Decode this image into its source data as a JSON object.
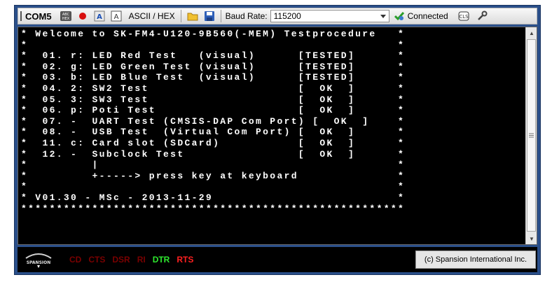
{
  "toolbar": {
    "port": "COM5",
    "mode_label": "ASCII / HEX",
    "baud_label": "Baud Rate:",
    "baud_value": "115200",
    "connection_status": "Connected",
    "icons": [
      "hex-toggle-icon",
      "record-dot-icon",
      "abc-font-icon",
      "a-letter-icon",
      "open-folder-icon",
      "save-disk-icon",
      "dropdown-arrow-icon",
      "connected-check-icon",
      "clear-screen-icon",
      "settings-wrench-icon"
    ]
  },
  "terminal": {
    "lines": [
      "* Welcome to SK-FM4-U120-9B560(-MEM) Testprocedure   *",
      "*                                                    *",
      "*  01. r: LED Red Test   (visual)      [TESTED]      *",
      "*  02. g: LED Green Test (visual)      [TESTED]      *",
      "*  03. b: LED Blue Test  (visual)      [TESTED]      *",
      "*  04. 2: SW2 Test                     [  OK  ]      *",
      "*  05. 3: SW3 Test                     [  OK  ]      *",
      "*  06. p: Poti Test                    [  OK  ]      *",
      "*  07. -  UART Test (CMSIS-DAP Com Port) [  OK  ]    *",
      "*  08. -  USB Test  (Virtual Com Port) [  OK  ]      *",
      "*  11. c: Card slot (SDCard)           [  OK  ]      *",
      "*  12. -  Subclock Test                [  OK  ]      *",
      "*         |                                          *",
      "*         +-----> press key at keyboard              *",
      "*                                                    *",
      "* V01.30 - MSc - 2013-11-29                          *",
      "******************************************************"
    ]
  },
  "statusbar": {
    "logo_text": "SPANSION",
    "signals": [
      {
        "label": "CD",
        "color": "#7a0000"
      },
      {
        "label": "CTS",
        "color": "#7a0000"
      },
      {
        "label": "DSR",
        "color": "#7a0000"
      },
      {
        "label": "RI",
        "color": "#7a0000"
      },
      {
        "label": "DTR",
        "color": "#2ee82e"
      },
      {
        "label": "RTS",
        "color": "#ff2020"
      }
    ],
    "copyright": "(c) Spansion International Inc."
  }
}
